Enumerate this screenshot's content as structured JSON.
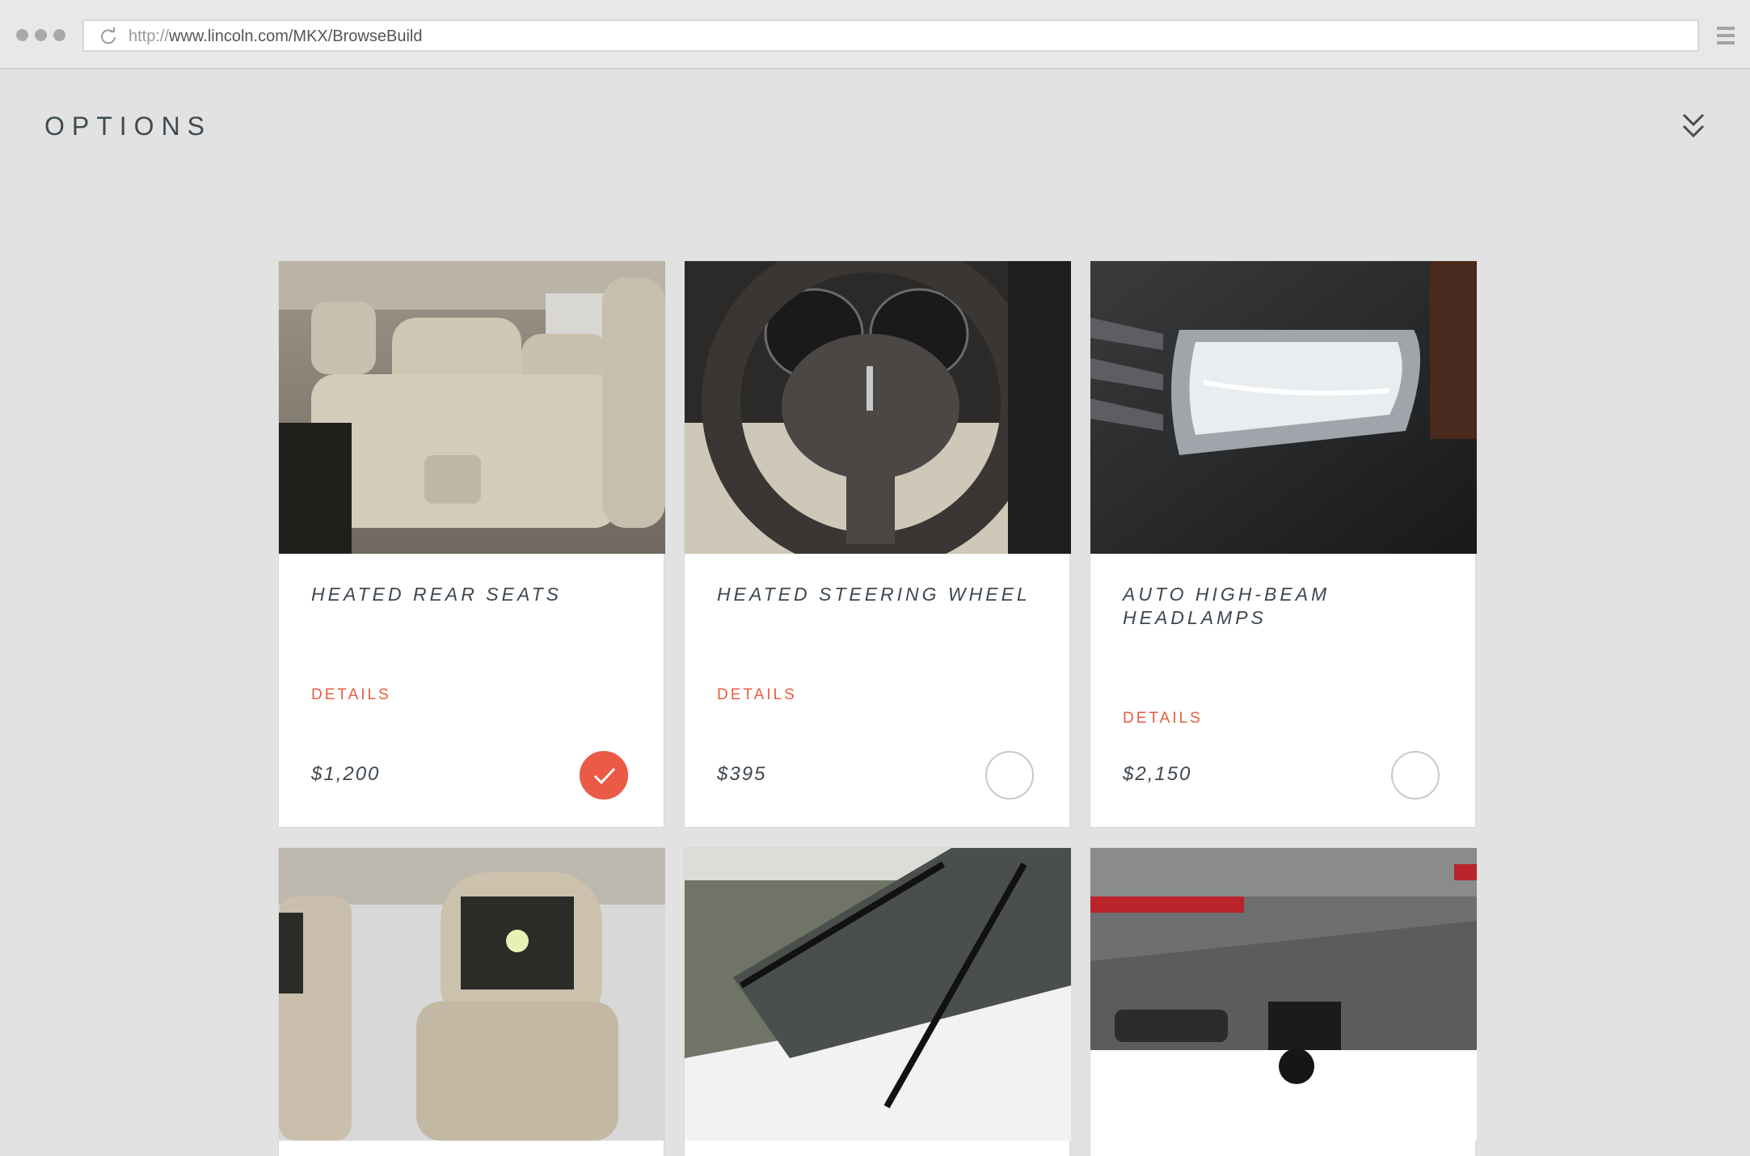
{
  "browser": {
    "url_protocol": "http://",
    "url_path": "www.lincoln.com/MKX/BrowseBuild"
  },
  "page": {
    "title": "OPTIONS"
  },
  "options": [
    {
      "title": "HEATED REAR SEATS",
      "details_label": "DETAILS",
      "price": "$1,200",
      "selected": true,
      "image": "rear-seats-photo"
    },
    {
      "title": "HEATED STEERING WHEEL",
      "details_label": "DETAILS",
      "price": "$395",
      "selected": false,
      "image": "steering-wheel-photo"
    },
    {
      "title": "AUTO HIGH-BEAM HEADLAMPS",
      "details_label": "DETAILS",
      "price": "$2,150",
      "selected": false,
      "image": "headlamp-photo"
    },
    {
      "image": "rear-entertainment-headrest-photo"
    },
    {
      "image": "windshield-wipers-photo"
    },
    {
      "image": "tow-hitch-photo"
    }
  ],
  "colors": {
    "accent": "#ea5a45",
    "details_link": "#e85c40",
    "text_dark": "#3e4850",
    "page_bg": "#e2e2e2"
  }
}
